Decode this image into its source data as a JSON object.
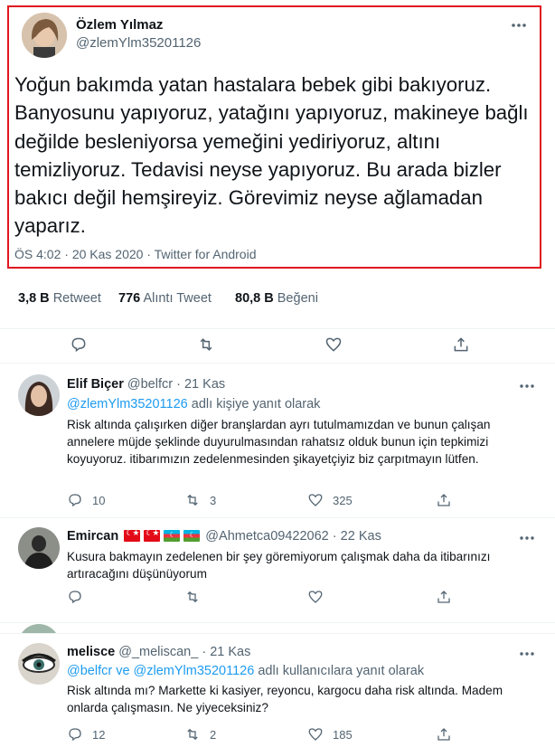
{
  "main_tweet": {
    "name": "Özlem Yılmaz",
    "handle": "@zlemYlm35201126",
    "text": "Yoğun bakımda yatan hastalara bebek gibi bakıyoruz. Banyosunu yapıyoruz, yatağını yapıyoruz, makineye bağlı değilde besleniyorsa yemeğini yediriyoruz, altını temizliyoruz. Tedavisi neyse yapıyoruz. Bu arada bizler bakıcı değil hemşireyiz. Görevimiz neyse ağlamadan yaparız.",
    "time": "ÖS 4:02",
    "date": "20 Kas 2020",
    "source": "Twitter for Android",
    "sep": "·"
  },
  "stats": {
    "retweets_count": "3,8 B",
    "retweets_label": "Retweet",
    "quotes_count": "776",
    "quotes_label": "Alıntı Tweet",
    "likes_count": "80,8 B",
    "likes_label": "Beğeni"
  },
  "replies": [
    {
      "name": "Elif Biçer",
      "handle": "@belfcr",
      "time": "21 Kas",
      "replying_mentions": "@zlemYlm35201126",
      "replying_suffix": "adlı kişiye yanıt olarak",
      "text": "Risk altında çalışırken diğer branşlardan ayrı tutulmamızdan ve bunun çalışan annelere müjde şeklinde duyurulmasından rahatsız olduk bunun için tepkimizi koyuyoruz. itibarımızın zedelenmesinden şikayetçiyiz biz çarpıtmayın lütfen.",
      "reply_count": "10",
      "retweet_count": "3",
      "like_count": "325"
    },
    {
      "name": "Emircan",
      "handle": "@Ahmetca09422062",
      "time": "22 Kas",
      "text": "Kusura bakmayın zedelenen bir şey göremiyorum çalışmak daha da itibarınızı artıracağını düşünüyorum"
    },
    {
      "name": "melisce",
      "handle": "@_meliscan_",
      "time": "21 Kas",
      "replying_mentions": "@belfcr ve @zlemYlm35201126",
      "replying_suffix": "adlı kullanıcılara yanıt olarak",
      "text": "Risk altında mı? Markette ki kasiyer, reyoncu, kargocu daha risk altında. Madem onlarda çalışmasın. Ne yiyeceksiniz?",
      "reply_count": "12",
      "retweet_count": "2",
      "like_count": "185"
    }
  ],
  "colors": {
    "highlight_border": "#e0161f",
    "link": "#1d9bf0",
    "muted": "#536471"
  }
}
